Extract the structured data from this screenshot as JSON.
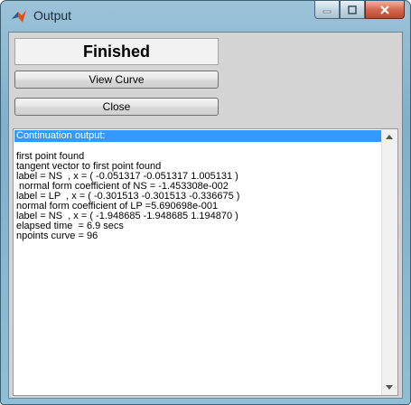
{
  "window": {
    "title": "Output"
  },
  "status": {
    "text": "Finished"
  },
  "buttons": {
    "view_curve": "View Curve",
    "close": "Close"
  },
  "output": {
    "header": "Continuation output:",
    "lines": [
      "",
      "first point found",
      "tangent vector to first point found",
      "label = NS  , x = ( -0.051317 -0.051317 1.005131 )",
      " normal form coefficient of NS = -1.453308e-002",
      "label = LP  , x = ( -0.301513 -0.301513 -0.336675 )",
      "normal form coefficient of LP =5.690698e-001",
      "label = NS  , x = ( -1.948685 -1.948685 1.194870 )",
      "elapsed time  = 6.9 secs",
      "npoints curve = 96"
    ]
  },
  "icons": {
    "app": "matlab-icon",
    "minimize": "minimize-icon",
    "maximize": "maximize-icon",
    "close": "close-icon"
  }
}
